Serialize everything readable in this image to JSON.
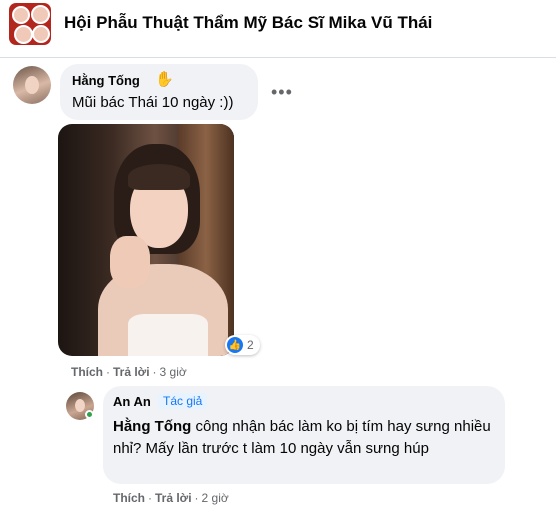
{
  "group": {
    "title": "Hội Phẫu Thuật Thẩm Mỹ Bác Sĩ Mika Vũ Thái"
  },
  "comment": {
    "author": "Hằng Tống",
    "author_badge_icon": "wave-hand-icon",
    "text": "Mũi bác Thái 10 ngày :))",
    "reactions": {
      "icon": "like-icon",
      "count": "2"
    },
    "actions": {
      "like": "Thích",
      "reply": "Trả lời",
      "time": "3 giờ"
    }
  },
  "reply": {
    "author": "An An",
    "badge": "Tác giả",
    "mention": "Hằng Tống",
    "text": " công nhận bác làm ko bị tím hay sưng nhiều nhỉ? Mấy lần trước t làm 10 ngày vẫn sưng húp",
    "actions": {
      "like": "Thích",
      "reply": "Trả lời",
      "time": "2 giờ"
    }
  },
  "colors": {
    "accent": "#1877f2",
    "bubble": "#f0f2f5",
    "secondary_text": "#65676b",
    "online": "#31a24c"
  }
}
